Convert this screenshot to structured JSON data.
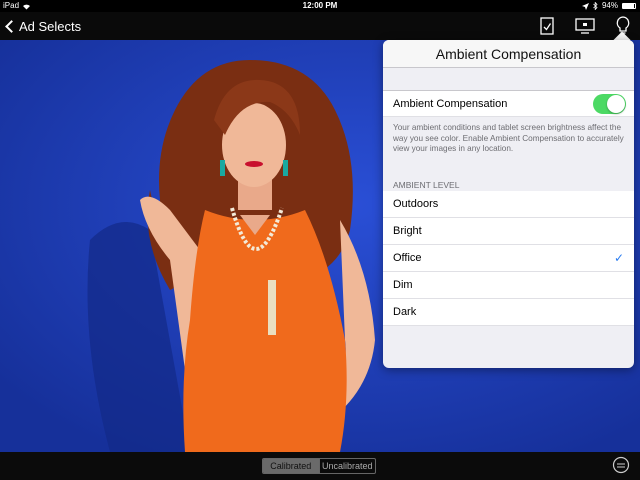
{
  "status": {
    "device": "iPad",
    "time": "12:00 PM",
    "battery": "94%"
  },
  "nav": {
    "back_label": "Ad Selects"
  },
  "popover": {
    "title": "Ambient Compensation",
    "toggle_label": "Ambient Compensation",
    "toggle_on": true,
    "description": "Your ambient conditions and tablet screen brightness affect the way you see color.  Enable Ambient Compensation to accurately view your images in any location.",
    "section_header": "AMBIENT LEVEL",
    "levels": [
      "Outdoors",
      "Bright",
      "Office",
      "Dim",
      "Dark"
    ],
    "selected_level": "Office",
    "check_mark": "✓"
  },
  "bottom": {
    "calibrated_label": "Calibrated",
    "uncalibrated_label": "Uncalibrated"
  },
  "colors": {
    "toggle_green": "#4cd964",
    "accent_blue": "#2a7cf0",
    "backdrop_blue": "#1f3fbf",
    "dress_orange": "#f06a1c"
  }
}
